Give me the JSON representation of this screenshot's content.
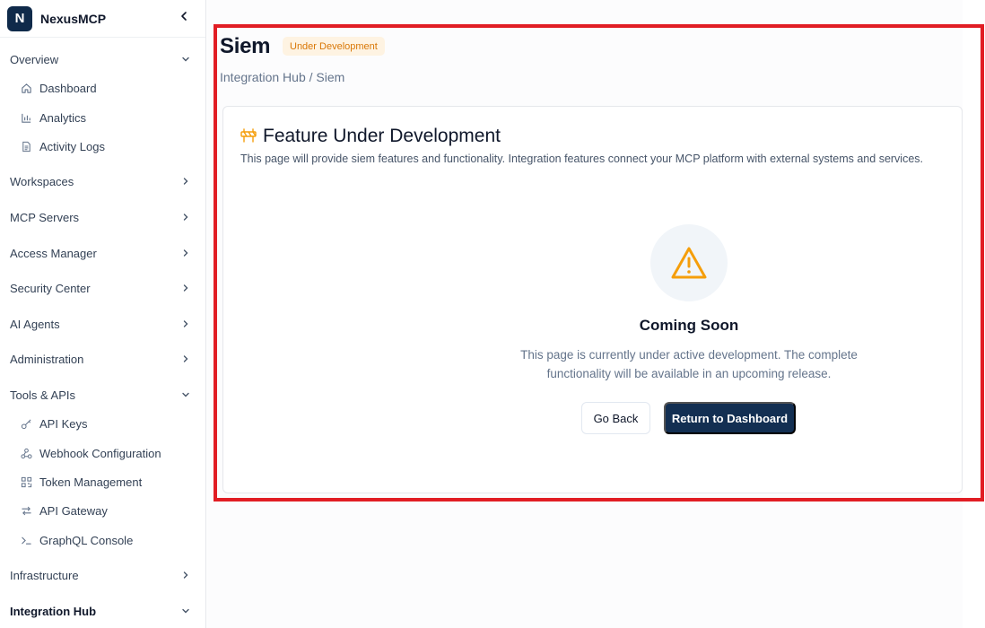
{
  "app": {
    "logo_letter": "N",
    "name": "NexusMCP"
  },
  "sidebar": {
    "overview": {
      "label": "Overview",
      "items": [
        {
          "label": "Dashboard",
          "icon": "home-icon"
        },
        {
          "label": "Analytics",
          "icon": "bar-chart-icon"
        },
        {
          "label": "Activity Logs",
          "icon": "file-text-icon"
        }
      ]
    },
    "workspaces": "Workspaces",
    "mcp_servers": "MCP Servers",
    "access_manager": "Access Manager",
    "security_center": "Security Center",
    "ai_agents": "AI Agents",
    "administration": "Administration",
    "tools": {
      "label": "Tools & APIs",
      "items": [
        {
          "label": "API Keys",
          "icon": "key-icon"
        },
        {
          "label": "Webhook Configuration",
          "icon": "webhook-icon"
        },
        {
          "label": "Token Management",
          "icon": "qr-code-icon"
        },
        {
          "label": "API Gateway",
          "icon": "arrows-swap-icon"
        },
        {
          "label": "GraphQL Console",
          "icon": "terminal-icon"
        }
      ]
    },
    "infrastructure": "Infrastructure",
    "integration_hub": "Integration Hub"
  },
  "page": {
    "title": "Siem",
    "badge": "Under Development",
    "breadcrumb": "Integration Hub / Siem"
  },
  "card": {
    "title": "Feature Under Development",
    "description": "This page will provide siem features and functionality. Integration features connect your MCP platform with external systems and services.",
    "coming_soon": "Coming Soon",
    "coming_desc": "This page is currently under active development. The complete functionality will be available in an upcoming release.",
    "back_label": "Go Back",
    "dashboard_label": "Return to Dashboard"
  },
  "colors": {
    "brand": "#0f2a4a",
    "warning": "#f59e0b",
    "highlight": "#e11d24",
    "primary_button": "#132f52"
  }
}
